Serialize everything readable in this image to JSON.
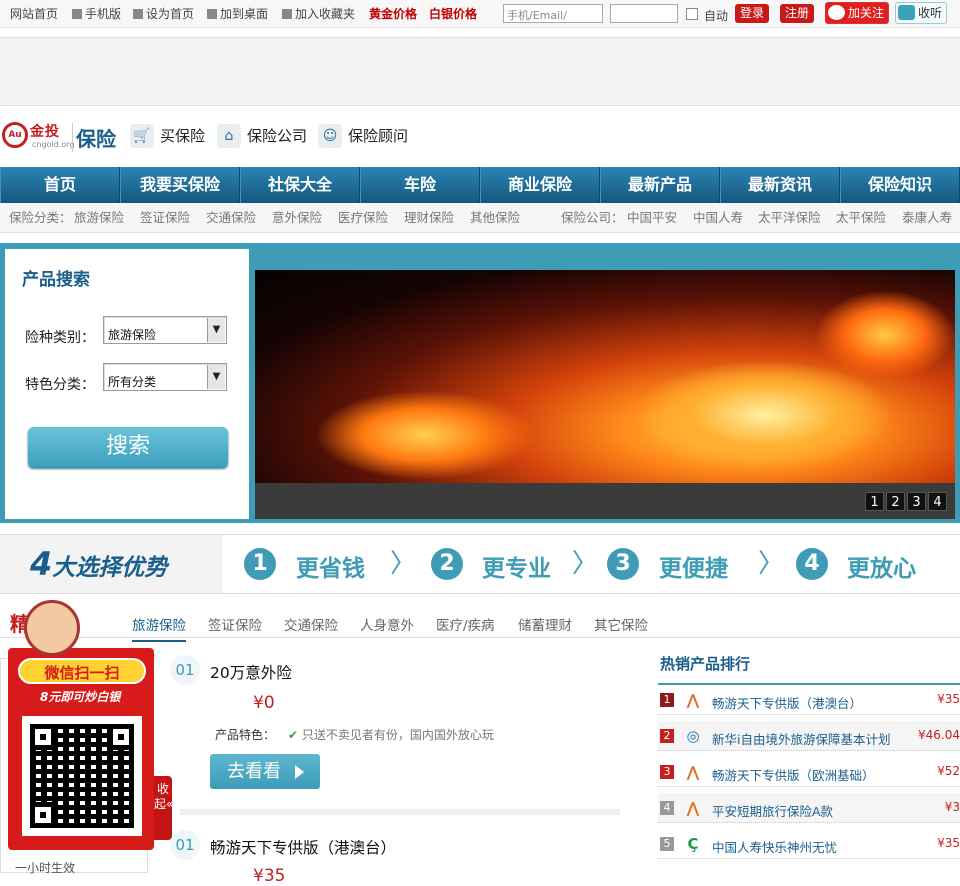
{
  "topbar": {
    "links": [
      "网站首页",
      "手机版",
      "设为首页",
      "加到桌面",
      "加入收藏夹"
    ],
    "gold": "黄金价格",
    "silver": "白银价格",
    "login_placeholder": "手机/Email/",
    "auto": "自动",
    "login": "登录",
    "register": "注册",
    "weibo": "加关注",
    "listen": "收听"
  },
  "header": {
    "logo_jin": "金投",
    "logo_org": "cngold.org",
    "logo_section": "保险",
    "nav": [
      "买保险",
      "保险公司",
      "保险顾问"
    ]
  },
  "main_nav": [
    "首页",
    "我要买保险",
    "社保大全",
    "车险",
    "商业保险",
    "最新产品",
    "最新资讯",
    "保险知识"
  ],
  "sub_nav": {
    "cat_label": "保险分类：",
    "cats": [
      "旅游保险",
      "签证保险",
      "交通保险",
      "意外保险",
      "医疗保险",
      "理财保险",
      "其他保险"
    ],
    "comp_label": "保险公司：",
    "comps": [
      "中国平安",
      "中国人寿",
      "太平洋保险",
      "太平保险",
      "泰康人寿"
    ]
  },
  "search": {
    "title": "产品搜索",
    "type_label": "险种类别：",
    "type_value": "旅游保险",
    "feature_label": "特色分类：",
    "feature_value": "所有分类",
    "button": "搜索"
  },
  "banner": {
    "pages": [
      "1",
      "2",
      "3",
      "4"
    ]
  },
  "advantages": {
    "num": "4",
    "title": "大选择优势",
    "items": [
      {
        "n": "1",
        "t": "更省钱"
      },
      {
        "n": "2",
        "t": "更专业"
      },
      {
        "n": "3",
        "t": "更便捷"
      },
      {
        "n": "4",
        "t": "更放心"
      }
    ]
  },
  "product_tabs": {
    "heading": "精",
    "tabs": [
      "旅游保险",
      "签证保险",
      "交通保险",
      "人身意外",
      "医疗/疾病",
      "储蓄理财",
      "其它保险"
    ]
  },
  "products": [
    {
      "n": "01",
      "name": "20万意外险",
      "price": "¥0",
      "feat_label": "产品特色：",
      "feat": "只送不卖见者有份，国内国外放心玩",
      "btn": "去看看"
    },
    {
      "n": "01",
      "name": "畅游天下专供版（港澳台）",
      "price": "¥35"
    }
  ],
  "hot": {
    "title": "热销产品排行",
    "items": [
      {
        "rank": "1",
        "name": "畅游天下专供版（港澳台）",
        "price": "¥35",
        "color": "#8b1a1a"
      },
      {
        "rank": "2",
        "name": "新华i自由境外旅游保障基本计划",
        "price": "¥46.04",
        "color": "#c52020"
      },
      {
        "rank": "3",
        "name": "畅游天下专供版（欧洲基础）",
        "price": "¥52",
        "color": "#c52020"
      },
      {
        "rank": "4",
        "name": "平安短期旅行保险A款",
        "price": "¥3",
        "color": "#999999"
      },
      {
        "rank": "5",
        "name": "中国人寿快乐神州无忧",
        "price": "¥35",
        "color": "#999999"
      }
    ]
  },
  "popup": {
    "caption": "微信扫一扫",
    "sub": "8元即可炒白银",
    "collapse": "收起«",
    "side_text": "一小时生效"
  }
}
